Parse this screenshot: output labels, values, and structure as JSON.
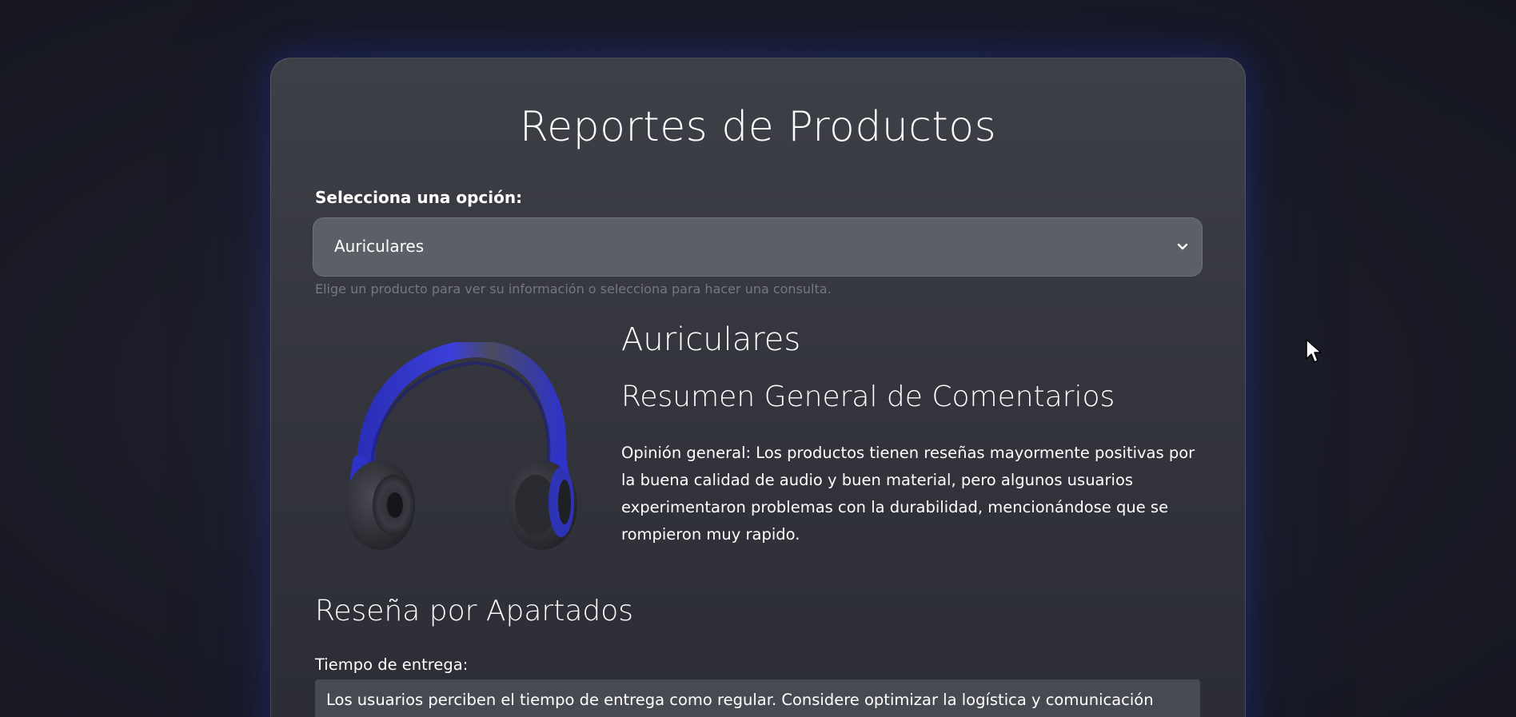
{
  "page": {
    "title": "Reportes de Productos"
  },
  "selector": {
    "label": "Selecciona una opción:",
    "selected": "Auriculares",
    "hint": "Elige un producto para ver su información o selecciona para hacer una consulta."
  },
  "product": {
    "name": "Auriculares",
    "image_icon": "headphones-icon",
    "summary_heading": "Resumen General de Comentarios",
    "summary_text": "Opinión general: Los productos tienen reseñas mayormente positivas por la buena calidad de audio y buen material, pero algunos usuarios experimentaron problemas con la durabilidad, mencionándose que se rompieron muy rapido."
  },
  "sections": {
    "heading": "Reseña por Apartados",
    "items": [
      {
        "label": "Tiempo de entrega:",
        "text": "Los usuarios perciben el tiempo de entrega como regular. Considere optimizar la logística y comunicación"
      }
    ]
  },
  "colors": {
    "accent": "#2f3ad6",
    "card_background": "#3a3b43",
    "select_background": "#5d5f67"
  }
}
